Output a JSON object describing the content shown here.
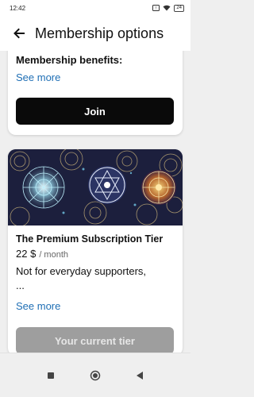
{
  "status_bar": {
    "time": "12:42",
    "battery": "24"
  },
  "header": {
    "title": "Membership options",
    "back_icon": "arrow-left-icon"
  },
  "cards": [
    {
      "benefits_heading": "Membership benefits:",
      "see_more": "See more",
      "action_label": "Join"
    },
    {
      "image": "mandala-pattern-illustration",
      "tier_name": "The Premium Subscription Tier",
      "price": "22 $",
      "period": "/ month",
      "description_line1": "Not for everyday supporters,",
      "description_line2": "...",
      "see_more": "See more",
      "action_label": "Your current tier",
      "action_disabled": true
    }
  ],
  "nav_bar": {
    "buttons": [
      "recent-apps-icon",
      "home-icon",
      "back-triangle-icon"
    ]
  },
  "colors": {
    "link": "#1f6fb5",
    "primary_button": "#0a0a0a",
    "disabled_button": "#9e9e9e",
    "background": "#efefef"
  }
}
